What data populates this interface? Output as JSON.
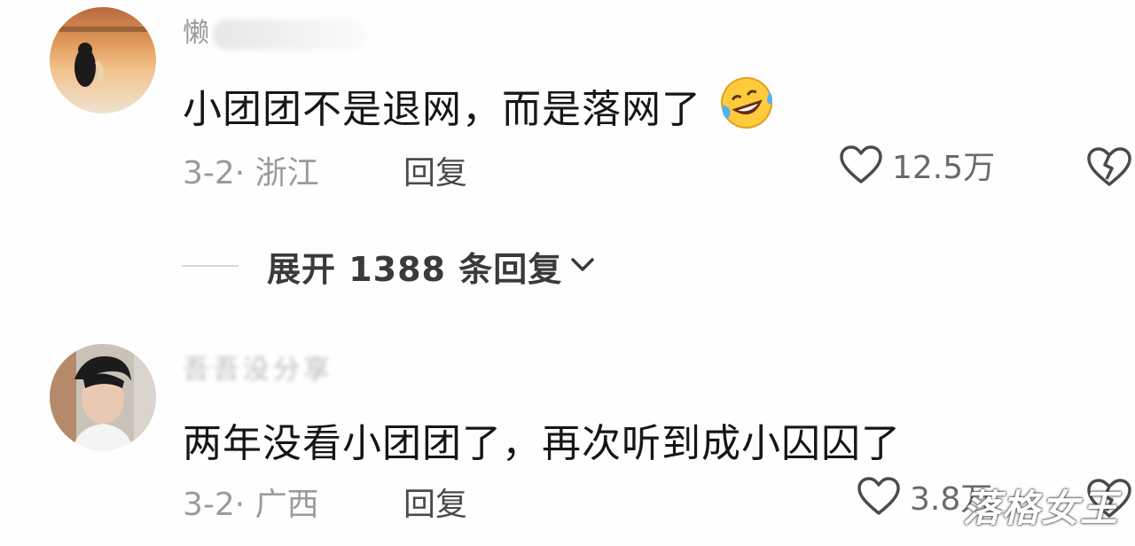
{
  "comments": [
    {
      "username_visible": "懒",
      "text": "小团团不是退网，而是落网了",
      "emoji": "rolling-on-floor-laughing",
      "date_location": "3-2· 浙江",
      "reply_label": "回复",
      "likes": "12.5万"
    },
    {
      "username_visible": "吾吾没分享",
      "text": "两年没看小团团了，再次听到成小囚囚了",
      "date_location": "3-2· 广西",
      "reply_label": "回复",
      "likes": "3.8万"
    }
  ],
  "expand_replies": {
    "label": "展开 1388 条回复"
  },
  "watermark": "落格女王",
  "colors": {
    "text_primary": "#161616",
    "text_secondary": "#9b9b9b",
    "divider": "#d6d6d6"
  }
}
